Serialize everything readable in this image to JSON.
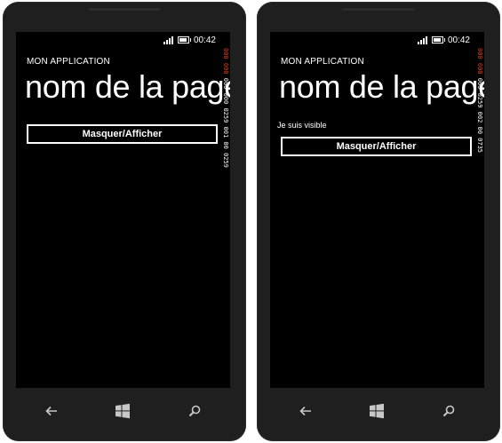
{
  "phones": [
    {
      "status": {
        "time": "00:42"
      },
      "app_title": "MON APPLICATION",
      "page_title": "nom de la page",
      "button_label": "Masquer/Afficher",
      "counters": {
        "red": "000 000",
        "white": "000 000 0259 001 00 0259"
      }
    },
    {
      "status": {
        "time": "00:42"
      },
      "app_title": "MON APPLICATION",
      "page_title": "nom de la page",
      "visible_text": "Je suis visible",
      "button_label": "Masquer/Afficher",
      "counters": {
        "red": "000 000",
        "white": "000 0259 002 00 0735"
      }
    }
  ],
  "colors": {
    "screen_bg": "#000000",
    "frame": "#1f1f1f",
    "counter_red": "#e0401e"
  },
  "nav_icons": [
    "back-arrow-icon",
    "windows-logo-icon",
    "search-icon"
  ]
}
